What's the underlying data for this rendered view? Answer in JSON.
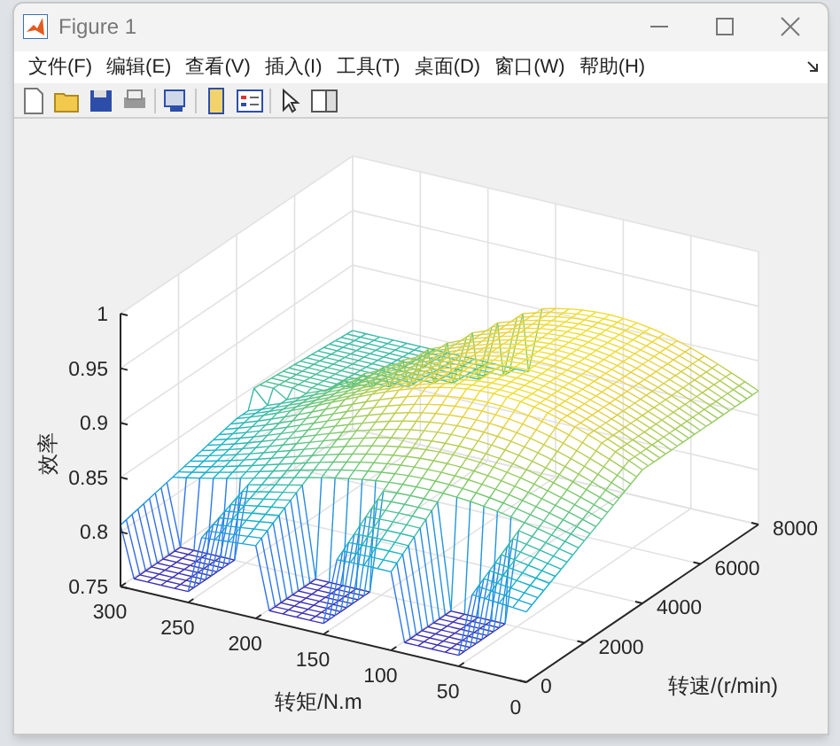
{
  "window": {
    "title": "Figure 1"
  },
  "menu": [
    "文件(F)",
    "编辑(E)",
    "查看(V)",
    "插入(I)",
    "工具(T)",
    "桌面(D)",
    "窗口(W)",
    "帮助(H)"
  ],
  "plot": {
    "zlabel": "效率",
    "xlabel": "转矩/N.m",
    "ylabel": "转速/(r/min)",
    "zticks": [
      "1",
      "0.95",
      "0.9",
      "0.85",
      "0.8",
      "0.75"
    ],
    "xticks": [
      "300",
      "250",
      "200",
      "150",
      "100",
      "50",
      "0"
    ],
    "yticks": [
      "0",
      "2000",
      "4000",
      "6000",
      "8000"
    ]
  }
}
